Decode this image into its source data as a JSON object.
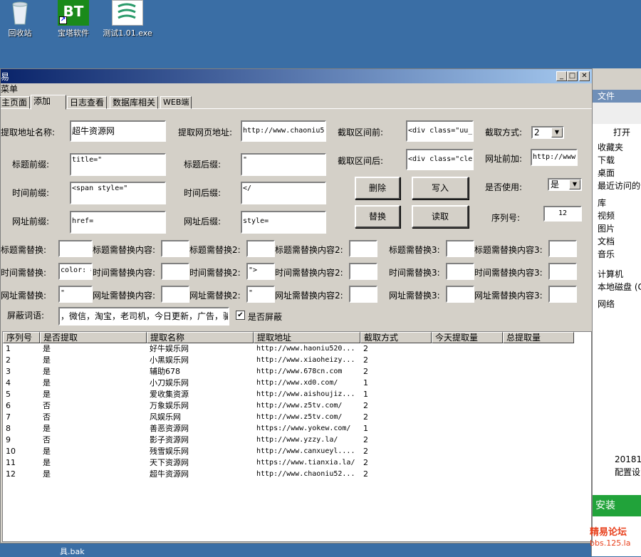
{
  "desktop": {
    "icons": [
      {
        "label": "回收站",
        "name": "recycle-bin-icon"
      },
      {
        "label": "宝塔软件",
        "name": "bt-panel-icon",
        "glyph": "BT"
      },
      {
        "label": "测试1.01.exe",
        "name": "exe-file-icon"
      }
    ],
    "taskbar_text": "具.bak"
  },
  "explorer": {
    "header": "文件",
    "open": "打开",
    "items": [
      "收藏夹",
      "下载",
      "桌面",
      "最近访问的位",
      "库",
      "视频",
      "图片",
      "文档",
      "音乐",
      "计算机",
      "本地磁盘 (C",
      "网络"
    ],
    "file_date": "20181",
    "file_name": "配置设",
    "install_btn": "安装"
  },
  "window": {
    "title": "易",
    "menu": "菜单",
    "tabs": [
      "主页面",
      "添加",
      "日志查看",
      "数据库相关",
      "WEB端"
    ],
    "form": {
      "site_name_label": "提取地址名称:",
      "site_name": "超牛资源网",
      "page_url_label": "提取网页地址:",
      "page_url": "http://www.chaoniu52",
      "range_start_label": "截取区间前:",
      "range_start": "<div class=\"uu_",
      "mode_label": "截取方式:",
      "mode": "2",
      "title_prefix_label": "标题前缀:",
      "title_prefix": "title=\"",
      "title_suffix_label": "标题后缀:",
      "title_suffix": "\"",
      "range_end_label": "截取区间后:",
      "range_end": "<div class=\"cle",
      "url_prepend_label": "网址前加:",
      "url_prepend": "http://www",
      "time_prefix_label": "时间前缀:",
      "time_prefix": "<span style=\"",
      "time_suffix_label": "时间后缀:",
      "time_suffix": "</",
      "enabled_label": "是否使用:",
      "enabled": "是",
      "url_prefix_label": "网址前缀:",
      "url_prefix": "href=",
      "url_suffix_label": "网址后缀:",
      "url_suffix": "style=",
      "serial_label": "序列号:",
      "serial": "12",
      "delete_btn": "删除",
      "write_btn": "写入",
      "replace_btn": "替换",
      "read_btn": "读取",
      "title_replace_label": "标题需替换:",
      "title_replace_content_label": "标题需替换内容:",
      "title_replace2_label": "标题需替换2:",
      "title_replace_content2_label": "标题需替换内容2:",
      "title_replace3_label": "标题需替换3:",
      "title_replace_content3_label": "标题需替换内容3:",
      "time_replace_label": "时间需替换:",
      "time_replace_value": "color: #",
      "time_replace_content_label": "时间需替换内容:",
      "time_replace2_label": "时间需替换2:",
      "time_replace2_value": "\">",
      "time_replace_content2_label": "时间需替换内容2:",
      "time_replace3_label": "时间需替换3:",
      "time_replace_content3_label": "时间需替换内容3:",
      "url_replace_label": "网址需替换:",
      "url_replace_value": "\"",
      "url_replace_content_label": "网址需替换内容:",
      "url_replace2_label": "网址需替换2:",
      "url_replace2_value": "\"",
      "url_replace_content2_label": "网址需替换内容2:",
      "url_replace3_label": "网址需替换3:",
      "url_replace_content3_label": "网址需替换内容3:",
      "block_words_label": "屏蔽词语:",
      "block_words": "，微信，淘宝，老司机，今日更新，广告，骗",
      "block_check_label": "是否屏蔽",
      "block_checked": "✔"
    },
    "table": {
      "columns": [
        "序列号",
        "是否提取",
        "提取名称",
        "提取地址",
        "截取方式",
        "今天提取量",
        "总提取量"
      ],
      "rows": [
        [
          "1",
          "是",
          "好牛娱乐网",
          "http://www.haoniu520...",
          "2"
        ],
        [
          "2",
          "是",
          "小黑娱乐网",
          "http://www.xiaoheizy...",
          "2"
        ],
        [
          "3",
          "是",
          "辅助678",
          "http://www.678cn.com",
          "2"
        ],
        [
          "4",
          "是",
          "小刀娱乐网",
          "http://www.xd0.com/",
          "1"
        ],
        [
          "5",
          "是",
          "爱收集资源",
          "http://www.aishoujiz...",
          "1"
        ],
        [
          "6",
          "否",
          "万象娱乐网",
          "http://www.z5tv.com/",
          "2"
        ],
        [
          "7",
          "否",
          "风娱乐网",
          "http://www.z5tv.com/",
          "2"
        ],
        [
          "8",
          "是",
          "善恶资源网",
          "https://www.yokew.com/",
          "1"
        ],
        [
          "9",
          "否",
          "影子资源网",
          "http://www.yzzy.la/",
          "2"
        ],
        [
          "10",
          "是",
          "残雪娱乐网",
          "http://www.canxueyl....",
          "2"
        ],
        [
          "11",
          "是",
          "天下资源网",
          "https://www.tianxia.la/",
          "2"
        ],
        [
          "12",
          "是",
          "超牛资源网",
          "http://www.chaoniu52...",
          "2"
        ]
      ]
    }
  },
  "watermark": {
    "line1": "精易论坛",
    "line2": "bbs.125.la"
  }
}
